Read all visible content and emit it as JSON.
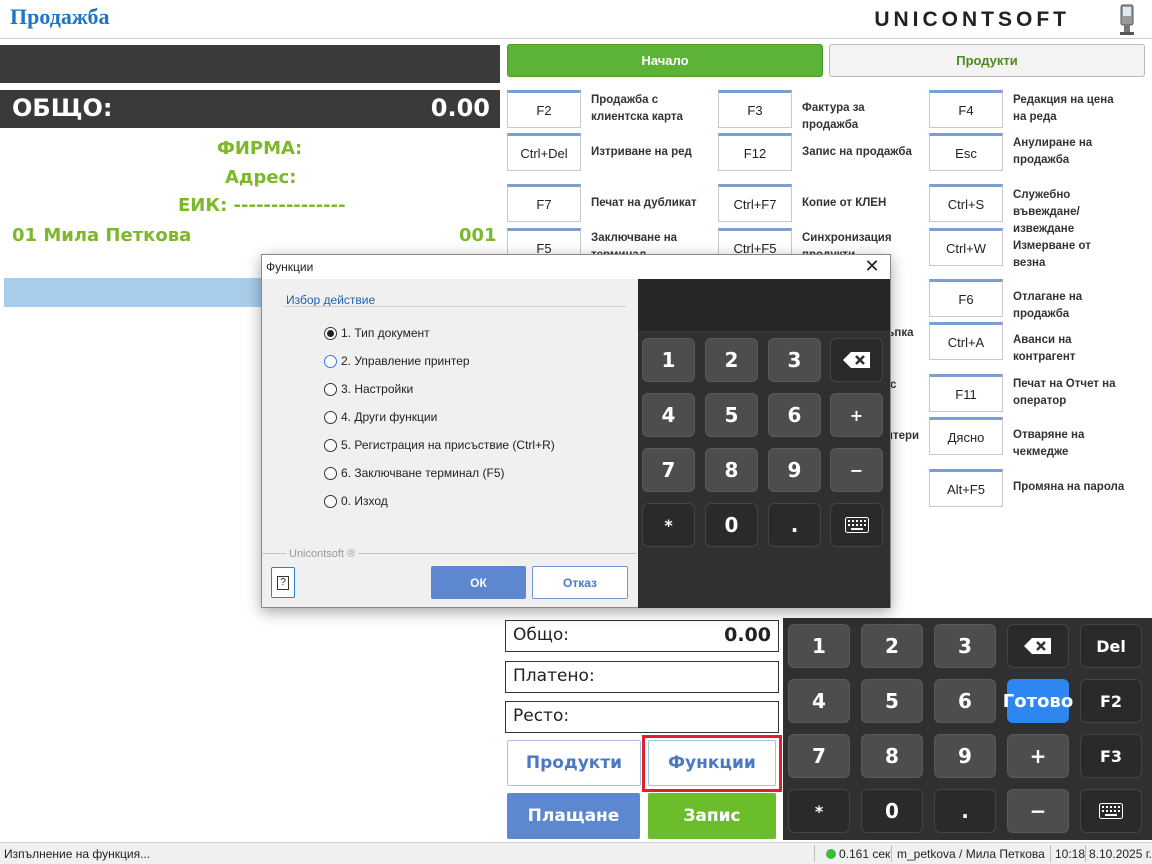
{
  "header": {
    "title": "Продажба",
    "brand": "UNICONTSOFT"
  },
  "total_bar": {
    "label": "ОБЩО:",
    "value": "0.00"
  },
  "client": {
    "firm": "ФИРМА:",
    "address": "Адрес:",
    "eik": "ЕИК: ---------------",
    "operator_name": "01 Мила Петкова",
    "operator_code": "001"
  },
  "tabs": {
    "start": "Начало",
    "products": "Продукти"
  },
  "shortcuts": [
    {
      "key": "F2",
      "label": "Продажба с клиентска карта"
    },
    {
      "key": "F3",
      "label": "Фактура за продажба"
    },
    {
      "key": "F4",
      "label": "Редакция на цена на реда"
    },
    {
      "key": "Ctrl+Del",
      "label": "Изтриване на ред"
    },
    {
      "key": "F12",
      "label": "Запис на продажба"
    },
    {
      "key": "Esc",
      "label": "Анулиране на продажба"
    },
    {
      "key": "F7",
      "label": "Печат на дубликат"
    },
    {
      "key": "Ctrl+F7",
      "label": "Копие от КЛЕН"
    },
    {
      "key": "Ctrl+S",
      "label": "Служебно въвеждане/извеждане"
    },
    {
      "key": "F5",
      "label": "Заключване на терминал"
    },
    {
      "key": "Ctrl+F5",
      "label": "Синхронизация продукти"
    },
    {
      "key": "Ctrl+W",
      "label": "Измерване от везна"
    },
    {
      "key": "F6",
      "label": "Отлагане на продажба"
    },
    {
      "key": "Ctrl+A",
      "label": "Аванси на контрагент"
    },
    {
      "key": "F11",
      "label": "Печат на Отчет на оператор"
    },
    {
      "key": "Дясно",
      "label": "Отваряне на чекмедже"
    },
    {
      "key": "Alt+F5",
      "label": "Промяна на парола"
    },
    {
      "partial": [
        "ъпка",
        "с",
        "нтери"
      ]
    }
  ],
  "summary": {
    "total_label": "Общо:",
    "total_value": "0.00",
    "paid_label": "Платено:",
    "change_label": "Ресто:"
  },
  "actions": {
    "products": "Продукти",
    "functions": "Функции",
    "pay": "Плащане",
    "save": "Запис"
  },
  "keypad": {
    "keys": [
      "1",
      "2",
      "3",
      "⌫",
      "Del",
      "4",
      "5",
      "6",
      "Готово",
      "F2",
      "7",
      "8",
      "9",
      "+",
      "F3",
      "*",
      "0",
      ".",
      "−",
      "⌨"
    ]
  },
  "status": {
    "message": "Изпълнение на функция...",
    "timing": "0.161 сек",
    "user": "m_petkova / Мила Петкова",
    "time": "10:18",
    "date": "8.10.2025 г."
  },
  "dialog": {
    "title": "Функции",
    "close": "✕",
    "group": "Избор действие",
    "options": [
      {
        "label": "1. Тип документ",
        "selected": true
      },
      {
        "label": "2. Управление принтер",
        "selected": false
      },
      {
        "label": "3. Настройки",
        "selected": false
      },
      {
        "label": "4. Други функции",
        "selected": false
      },
      {
        "label": "5. Регистрация на присъствие (Ctrl+R)",
        "selected": false
      },
      {
        "label": "6. Заключване терминал (F5)",
        "selected": false
      },
      {
        "label": "0. Изход",
        "selected": false
      }
    ],
    "brand": "Unicontsoft ®",
    "help": "?",
    "ok": "ОК",
    "cancel": "Отказ",
    "keypad": [
      "1",
      "2",
      "3",
      "⌫",
      "4",
      "5",
      "6",
      "+",
      "7",
      "8",
      "9",
      "−",
      "*",
      "0",
      ".",
      "⌨"
    ]
  },
  "colors": {
    "accent_blue": "#1e74c6",
    "green": "#6bbd2b",
    "highlight_red": "#e0202a",
    "keypad_dark": "#303030"
  }
}
